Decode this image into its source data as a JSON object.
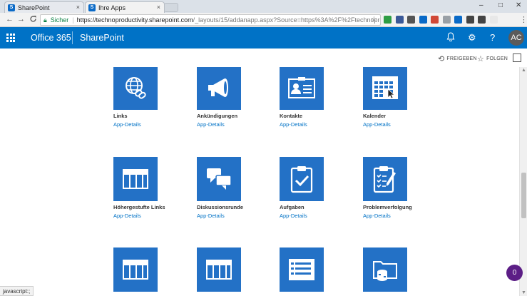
{
  "browser": {
    "tabs": [
      {
        "title": "SharePoint",
        "close": "×"
      },
      {
        "title": "Ihre Apps",
        "close": "×"
      }
    ],
    "window_controls": {
      "minimize": "–",
      "maximize": "□",
      "close": "✕"
    },
    "nav": {
      "back": "←",
      "forward": "→",
      "reload": "C"
    },
    "address": {
      "security_label": "Sicher",
      "url_host": "https://technoproductivity.sharepoint.com",
      "url_rest": "/_layouts/15/addanapp.aspx?Source=https%3A%2F%2Ftechnoproducti..."
    },
    "extension_colors": [
      "#2e9d44",
      "#3b5998",
      "#555555",
      "#0a6ac7",
      "#d14836",
      "#9aa0a6",
      "#0a6ac7",
      "#444444",
      "#444444",
      "#e8e8e8"
    ]
  },
  "suitebar": {
    "brand": "Office 365",
    "product": "SharePoint",
    "avatar_initials": "AC",
    "accent_color": "#0072c6"
  },
  "ribbon": {
    "share_label": "FREIGEBEN",
    "follow_label": "FOLGEN"
  },
  "apps": [
    {
      "title": "Links",
      "link": "App-Details",
      "icon": "globe-link-icon"
    },
    {
      "title": "Ankündigungen",
      "link": "App-Details",
      "icon": "megaphone-icon"
    },
    {
      "title": "Kontakte",
      "link": "App-Details",
      "icon": "contact-card-icon"
    },
    {
      "title": "Kalender",
      "link": "App-Details",
      "icon": "calendar-icon"
    },
    {
      "title": "Höhergestufte Links",
      "link": "App-Details",
      "icon": "table-icon"
    },
    {
      "title": "Diskussionsrunde",
      "link": "App-Details",
      "icon": "discussion-icon"
    },
    {
      "title": "Aufgaben",
      "link": "App-Details",
      "icon": "clipboard-check-icon"
    },
    {
      "title": "Problemverfolgung",
      "link": "App-Details",
      "icon": "clipboard-list-icon"
    },
    {
      "title": "",
      "link": "",
      "icon": "table-icon"
    },
    {
      "title": "",
      "link": "",
      "icon": "table-icon"
    },
    {
      "title": "",
      "link": "",
      "icon": "form-list-icon"
    },
    {
      "title": "",
      "link": "",
      "icon": "folder-database-icon"
    }
  ],
  "status_text": "javascript:;",
  "notification_count": "0",
  "tile_color": "#2371c6"
}
